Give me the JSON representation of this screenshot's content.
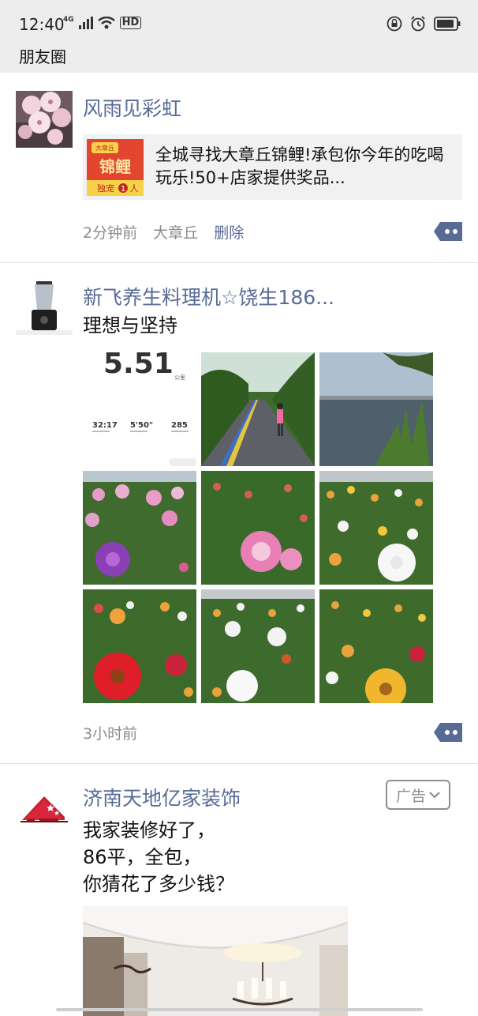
{
  "status_bar": {
    "time": "12:40",
    "network": "4G",
    "hd": "HD"
  },
  "nav": {
    "title": "朋友圈"
  },
  "posts": [
    {
      "name": "风雨见彩虹",
      "link_card": {
        "text": "全城寻找大章丘锦鲤!承包你今年的吃喝玩乐!50+店家提供奖品...",
        "thumb_lines": [
          "大章丘",
          "锦鲤",
          "独宠",
          "1",
          "人"
        ]
      },
      "time": "2分钟前",
      "location": "大章丘",
      "delete_label": "删除"
    },
    {
      "name": "新飞养生料理机☆饶生186...",
      "text": "理想与坚持",
      "run_stats": {
        "distance": "5.51",
        "unit": "公里",
        "duration": "32:17",
        "pace": "5'50\"",
        "calories": "285"
      },
      "photo_count": 9,
      "time": "3小时前"
    },
    {
      "name": "济南天地亿家装饰",
      "ad_label": "广告",
      "text_lines": [
        "我家装修好了，",
        "86平，全包，",
        "你猜花了多少钱？"
      ]
    }
  ],
  "colors": {
    "accent": "#576b95",
    "background": "#ffffff",
    "header": "#ededed"
  }
}
